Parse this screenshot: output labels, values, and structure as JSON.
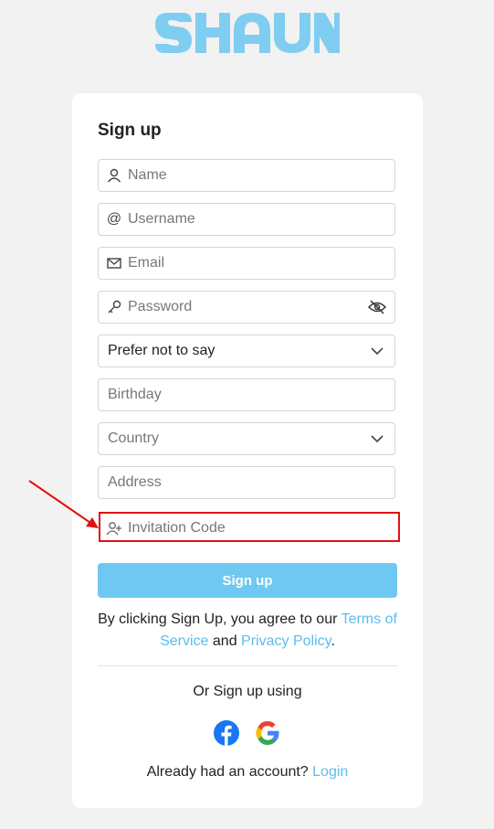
{
  "brand": {
    "logo_text": "SHAUN",
    "color": "#7fcdf0"
  },
  "form": {
    "title": "Sign up",
    "fields": {
      "name": {
        "placeholder": "Name"
      },
      "username": {
        "placeholder": "Username"
      },
      "email": {
        "placeholder": "Email"
      },
      "password": {
        "placeholder": "Password"
      },
      "gender": {
        "value": "Prefer not to say"
      },
      "birthday": {
        "placeholder": "Birthday"
      },
      "country": {
        "placeholder": "Country"
      },
      "address": {
        "placeholder": "Address"
      },
      "invitation": {
        "placeholder": "Invitation Code"
      }
    },
    "submit_label": "Sign up",
    "terms": {
      "prefix": "By clicking Sign Up, you agree to our ",
      "terms_link": "Terms of Service",
      "middle": " and ",
      "privacy_link": "Privacy Policy",
      "suffix": "."
    },
    "or_text": "Or Sign up using",
    "social": [
      "facebook-icon",
      "google-icon"
    ],
    "login_prompt": "Already had an account? ",
    "login_link": "Login"
  },
  "colors": {
    "accent": "#6fc8f2",
    "link": "#5cbcec",
    "highlight": "#e01010"
  }
}
